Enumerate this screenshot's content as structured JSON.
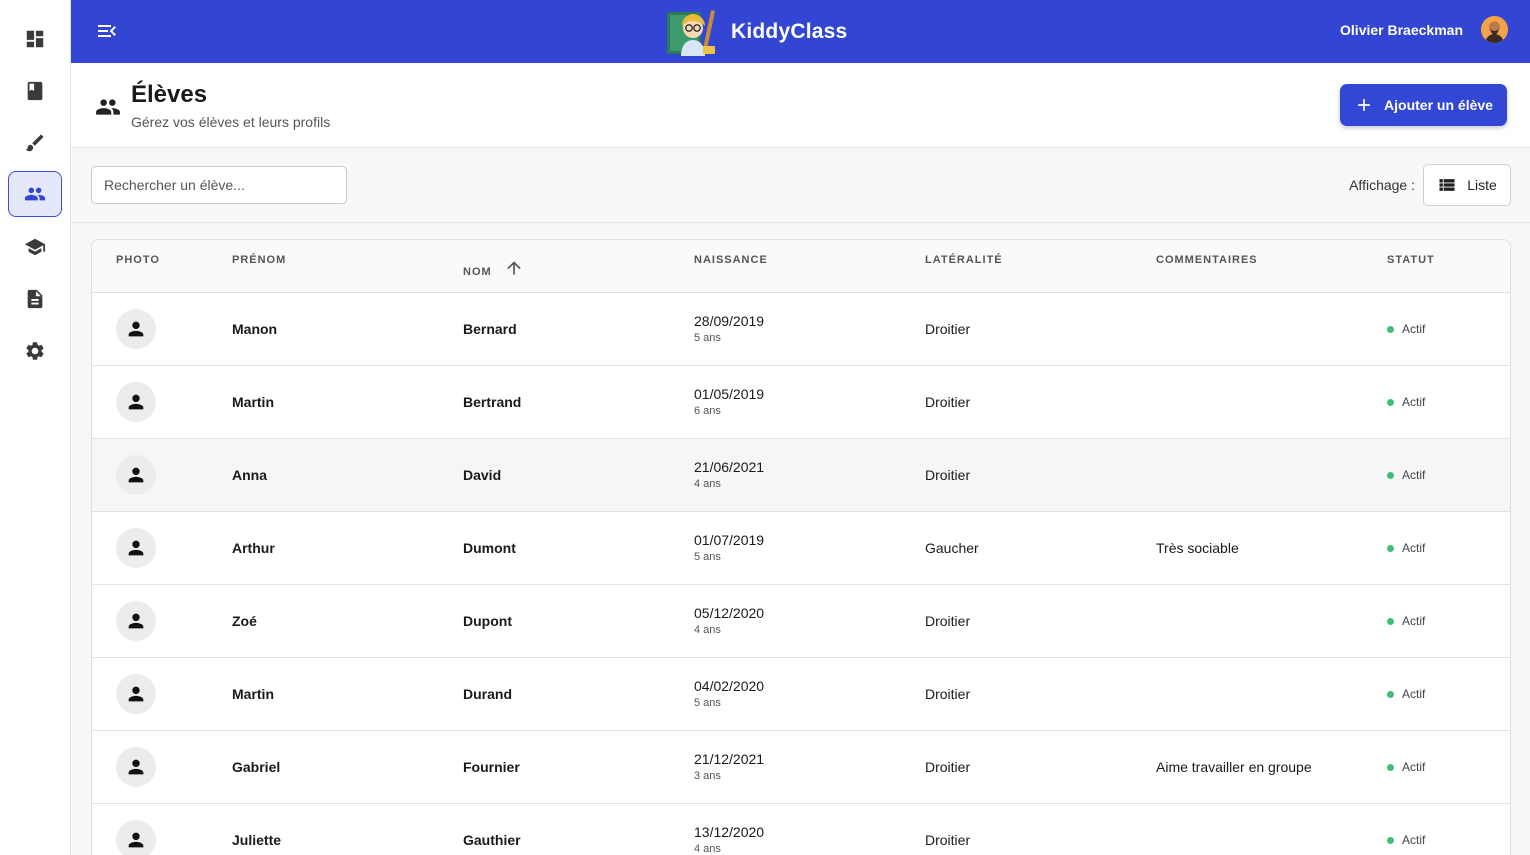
{
  "brand": {
    "name": "KiddyClass"
  },
  "user": {
    "name": "Olivier Braeckman"
  },
  "page": {
    "title": "Élèves",
    "subtitle": "Gérez vos élèves et leurs profils"
  },
  "actions": {
    "add_student": "Ajouter un élève"
  },
  "search": {
    "placeholder": "Rechercher un élève...",
    "value": ""
  },
  "view": {
    "label": "Affichage :",
    "mode": "Liste"
  },
  "rail": {
    "items": [
      {
        "name": "dashboard-icon",
        "active": false
      },
      {
        "name": "book-icon",
        "active": false
      },
      {
        "name": "brush-icon",
        "active": false
      },
      {
        "name": "students-icon",
        "active": true
      },
      {
        "name": "school-icon",
        "active": false
      },
      {
        "name": "document-icon",
        "active": false
      },
      {
        "name": "settings-icon",
        "active": false
      }
    ]
  },
  "table": {
    "columns": [
      "Photo",
      "Prénom",
      "Nom",
      "Naissance",
      "Latéralité",
      "Commentaires",
      "Statut"
    ],
    "rows": [
      {
        "first": "Manon",
        "last": "Bernard",
        "birth": "28/09/2019",
        "age": "5 ans",
        "hand": "Droitier",
        "comment": "",
        "status": "Actif"
      },
      {
        "first": "Martin",
        "last": "Bertrand",
        "birth": "01/05/2019",
        "age": "6 ans",
        "hand": "Droitier",
        "comment": "",
        "status": "Actif"
      },
      {
        "first": "Anna",
        "last": "David",
        "birth": "21/06/2021",
        "age": "4 ans",
        "hand": "Droitier",
        "comment": "",
        "status": "Actif"
      },
      {
        "first": "Arthur",
        "last": "Dumont",
        "birth": "01/07/2019",
        "age": "5 ans",
        "hand": "Gaucher",
        "comment": "Très sociable",
        "status": "Actif"
      },
      {
        "first": "Zoé",
        "last": "Dupont",
        "birth": "05/12/2020",
        "age": "4 ans",
        "hand": "Droitier",
        "comment": "",
        "status": "Actif"
      },
      {
        "first": "Martin",
        "last": "Durand",
        "birth": "04/02/2020",
        "age": "5 ans",
        "hand": "Droitier",
        "comment": "",
        "status": "Actif"
      },
      {
        "first": "Gabriel",
        "last": "Fournier",
        "birth": "21/12/2021",
        "age": "3 ans",
        "hand": "Droitier",
        "comment": "Aime travailler en groupe",
        "status": "Actif"
      },
      {
        "first": "Juliette",
        "last": "Gauthier",
        "birth": "13/12/2020",
        "age": "4 ans",
        "hand": "Droitier",
        "comment": "",
        "status": "Actif"
      }
    ]
  },
  "colors": {
    "primary": "#3246d3",
    "status_active": "#3fbf76"
  }
}
